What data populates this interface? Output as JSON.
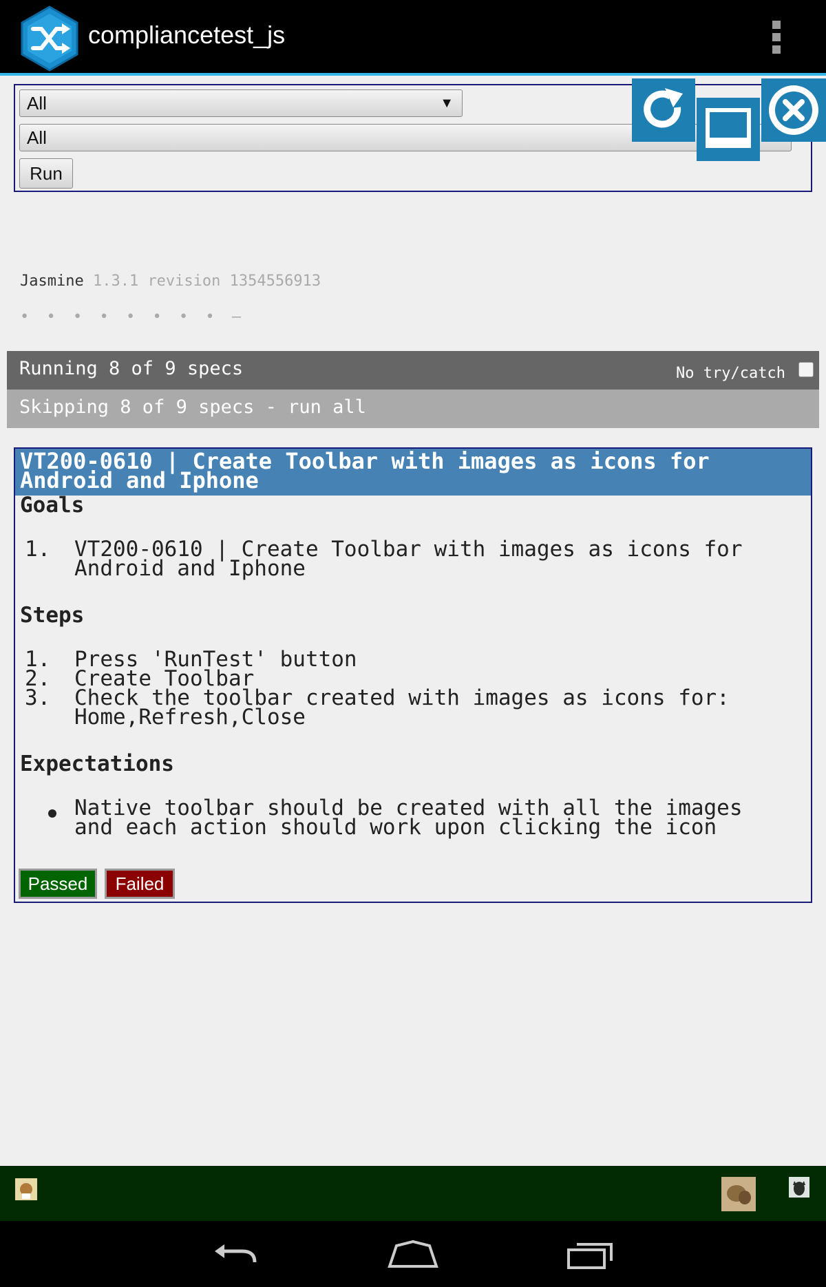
{
  "action_bar": {
    "title": "compliancetest_js",
    "logo_icon": "shuffle-logo-icon",
    "overflow_icon": "overflow-menu-icon"
  },
  "filters": {
    "suite_selected": "All",
    "spec_selected": "All",
    "run_label": "Run"
  },
  "overlay_toolbar": {
    "icons": [
      "refresh-icon",
      "home-icon",
      "close-icon"
    ],
    "color": "#1d7fb2"
  },
  "jasmine": {
    "title": "Jasmine",
    "version": "1.3.1 revision 1354556913",
    "dots": "• • • • • • • • –"
  },
  "status": {
    "running": "Running 8 of 9 specs",
    "no_try_catch": "No try/catch",
    "skipping": "Skipping 8 of 9 specs - run all"
  },
  "test": {
    "heading_line1": "VT200-0610 | Create Toolbar with images as icons for",
    "heading_line2": "Android and Iphone",
    "goals_title": "Goals",
    "goals": [
      {
        "num": "1.",
        "line1": "VT200-0610 | Create Toolbar with images as icons for",
        "line2": "Android and Iphone"
      }
    ],
    "steps_title": "Steps",
    "steps": [
      {
        "num": "1.",
        "line1": "Press 'RunTest' button"
      },
      {
        "num": "2.",
        "line1": "Create Toolbar"
      },
      {
        "num": "3.",
        "line1": "Check the toolbar created with images as icons for:",
        "line2": "Home,Refresh,Close"
      }
    ],
    "expectations_title": "Expectations",
    "expectations": [
      {
        "line1": "Native toolbar should be created with all the images",
        "line2": "and each action should work upon clicking the icon"
      }
    ],
    "passed_label": "Passed",
    "failed_label": "Failed"
  },
  "colors": {
    "heading_bg": "#4682b4",
    "passed": "#006400",
    "failed": "#8b0000",
    "accent": "#33b5e5",
    "bottom_bar": "#032b03"
  }
}
